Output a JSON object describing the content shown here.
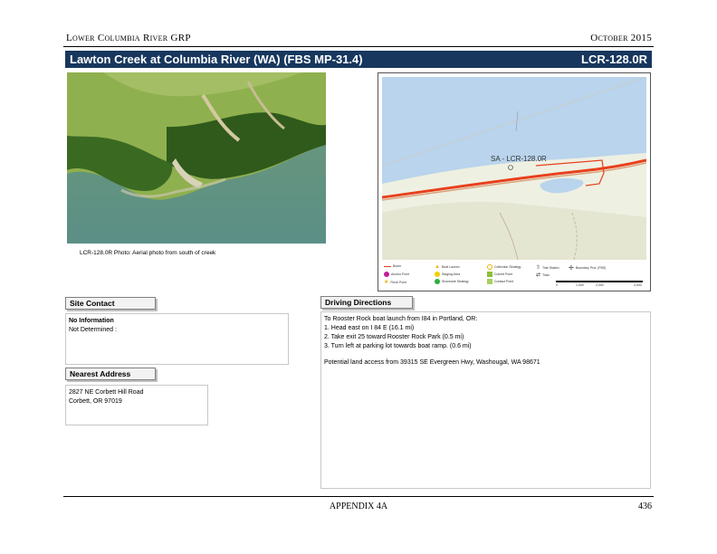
{
  "header": {
    "left": "Lower Columbia River GRP",
    "right": "October 2015"
  },
  "title_bar": {
    "title": "Lawton Creek at Columbia River (WA) (FBS MP-31.4)",
    "code": "LCR-128.0R"
  },
  "photo": {
    "caption": "LCR-128.0R Photo: Aerial photo from south of creek"
  },
  "map": {
    "site_label": "SA - LCR-128.0R",
    "legend": [
      {
        "label": "Boom",
        "symbol": "line-orange"
      },
      {
        "label": "Anchor Point",
        "symbol": "dot-magenta"
      },
      {
        "label": "Flush Point",
        "symbol": "star-yellow"
      },
      {
        "label": "Boat Launch",
        "symbol": "triangle-yellow"
      },
      {
        "label": "Staging Area",
        "symbol": "dot-yellow"
      },
      {
        "label": "Shoreside Strategy",
        "symbol": "dot-green"
      },
      {
        "label": "Collection Strategy",
        "symbol": "circle-yellow"
      },
      {
        "label": "Culvert Point",
        "symbol": "square-green"
      },
      {
        "label": "Contact Point",
        "symbol": "square-lime"
      },
      {
        "label": "Tide Station",
        "symbol": "arrow-black"
      },
      {
        "label": "Tidal",
        "symbol": "arrow-double"
      },
      {
        "label": "Boundary Prot. (FBS)",
        "symbol": "compass"
      }
    ],
    "scale_labels": [
      "0",
      "1,000",
      "2,000",
      "4,000"
    ]
  },
  "site_contact": {
    "heading": "Site Contact",
    "name": "No Information",
    "detail": "Not Determined :"
  },
  "nearest_address": {
    "heading": "Nearest Address",
    "line1": "2827 NE Corbett Hill Road",
    "line2": "Corbett, OR  97019"
  },
  "driving_directions": {
    "heading": "Driving Directions",
    "lines": [
      "To Rooster Rock boat launch from I84 in Portland, OR:",
      "1. Head east on I 84 E (16.1 mi)",
      "2. Take exit 25 toward Rooster Rock Park (0.5 mi)",
      "3. Turn left at parking lot towards boat ramp. (0.6 mi)"
    ],
    "note": "Potential land access from 39315 SE Evergreen Hwy, Washougal, WA 98671"
  },
  "footer": {
    "center": "APPENDIX 4A",
    "page": "436"
  },
  "colors": {
    "title_bar": "#17375e",
    "boom": "#e8401c",
    "water": "#b9d4ec"
  }
}
